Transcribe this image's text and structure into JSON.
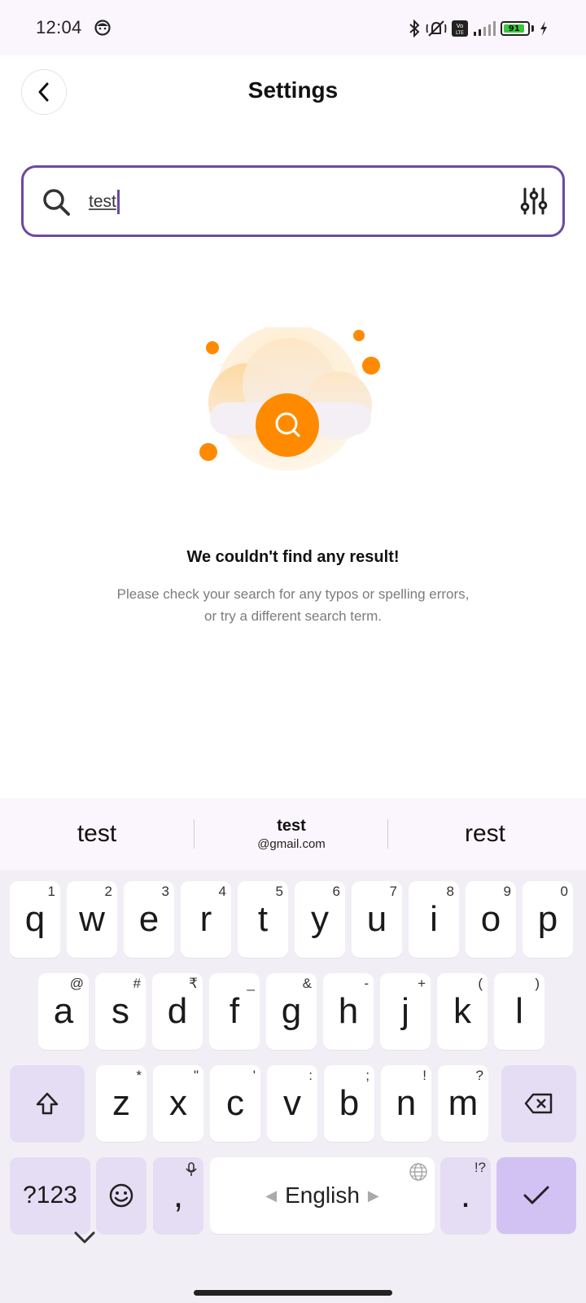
{
  "status_bar": {
    "time": "12:04",
    "battery_level": "91",
    "icons": [
      "face-icon",
      "bluetooth-icon",
      "silent-icon",
      "volte-icon",
      "signal-icon",
      "battery-icon",
      "charging-icon"
    ]
  },
  "header": {
    "title": "Settings",
    "back_icon": "chevron-left-icon"
  },
  "search": {
    "value": "test",
    "icon": "search-icon",
    "filter_icon": "filter-sliders-icon",
    "accent_color": "#6a4aa1"
  },
  "empty_state": {
    "title": "We couldn't find any result!",
    "description_line1": "Please check your search for any typos or spelling errors,",
    "description_line2": "or try a different search term.",
    "accent_color": "#ff8a00"
  },
  "keyboard": {
    "suggestions": {
      "left": "test",
      "center_main": "test",
      "center_sub": "@gmail.com",
      "right": "rest"
    },
    "row1": [
      {
        "key": "q",
        "hint": "1"
      },
      {
        "key": "w",
        "hint": "2"
      },
      {
        "key": "e",
        "hint": "3"
      },
      {
        "key": "r",
        "hint": "4"
      },
      {
        "key": "t",
        "hint": "5"
      },
      {
        "key": "y",
        "hint": "6"
      },
      {
        "key": "u",
        "hint": "7"
      },
      {
        "key": "i",
        "hint": "8"
      },
      {
        "key": "o",
        "hint": "9"
      },
      {
        "key": "p",
        "hint": "0"
      }
    ],
    "row2": [
      {
        "key": "a",
        "hint": "@"
      },
      {
        "key": "s",
        "hint": "#"
      },
      {
        "key": "d",
        "hint": "₹"
      },
      {
        "key": "f",
        "hint": "_"
      },
      {
        "key": "g",
        "hint": "&"
      },
      {
        "key": "h",
        "hint": "-"
      },
      {
        "key": "j",
        "hint": "+"
      },
      {
        "key": "k",
        "hint": "("
      },
      {
        "key": "l",
        "hint": ")"
      }
    ],
    "row3": [
      {
        "key": "z",
        "hint": "*"
      },
      {
        "key": "x",
        "hint": "\""
      },
      {
        "key": "c",
        "hint": "'"
      },
      {
        "key": "v",
        "hint": ":"
      },
      {
        "key": "b",
        "hint": ";"
      },
      {
        "key": "n",
        "hint": "!"
      },
      {
        "key": "m",
        "hint": "?"
      }
    ],
    "symbols_label": "?123",
    "comma_label": ",",
    "space_label": "English",
    "period_label": ".",
    "period_hint": "!?"
  }
}
